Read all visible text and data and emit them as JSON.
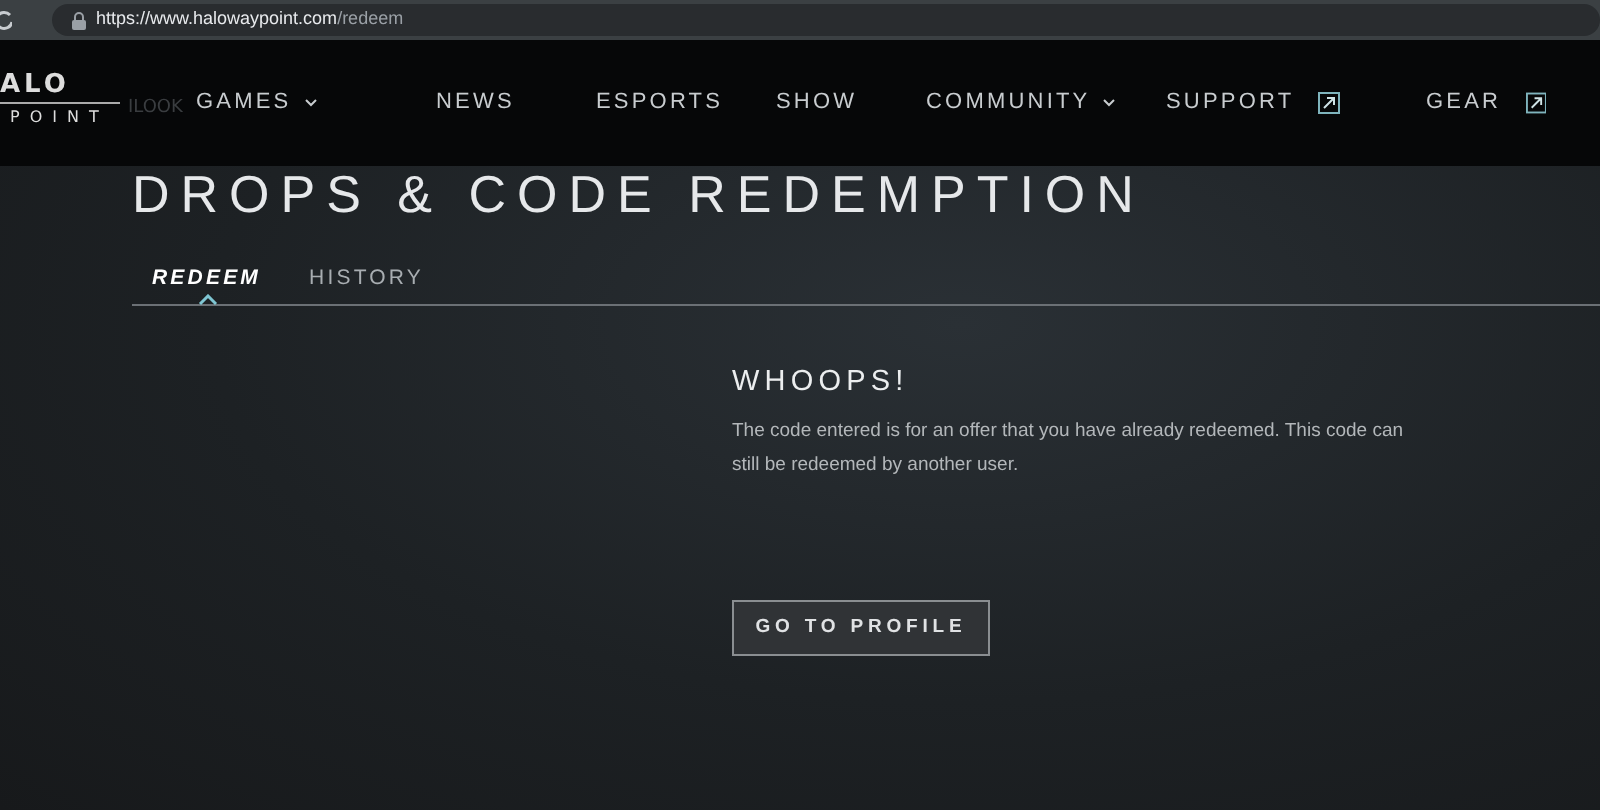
{
  "browser": {
    "url_host": "https://www.halowaypoint.com",
    "url_path": "/redeem"
  },
  "logo": {
    "top": "ALO",
    "bottom": "POINT"
  },
  "nav": [
    {
      "label": "GAMES",
      "kind": "dropdown"
    },
    {
      "label": "NEWS",
      "kind": "plain"
    },
    {
      "label": "ESPORTS",
      "kind": "plain"
    },
    {
      "label": "SHOW",
      "kind": "plain"
    },
    {
      "label": "COMMUNITY",
      "kind": "dropdown"
    },
    {
      "label": "SUPPORT",
      "kind": "external"
    },
    {
      "label": "GEAR",
      "kind": "external"
    }
  ],
  "behind_nav_text": "ILOOK",
  "page_title": "DROPS & CODE REDEMPTION",
  "tabs": [
    {
      "label": "REDEEM",
      "selected": true
    },
    {
      "label": "HISTORY",
      "selected": false
    }
  ],
  "message": {
    "heading": "WHOOPS!",
    "body": "The code entered is for an offer that you have already redeemed. This code can still be redeemed by another user.",
    "button": "GO TO PROFILE"
  }
}
